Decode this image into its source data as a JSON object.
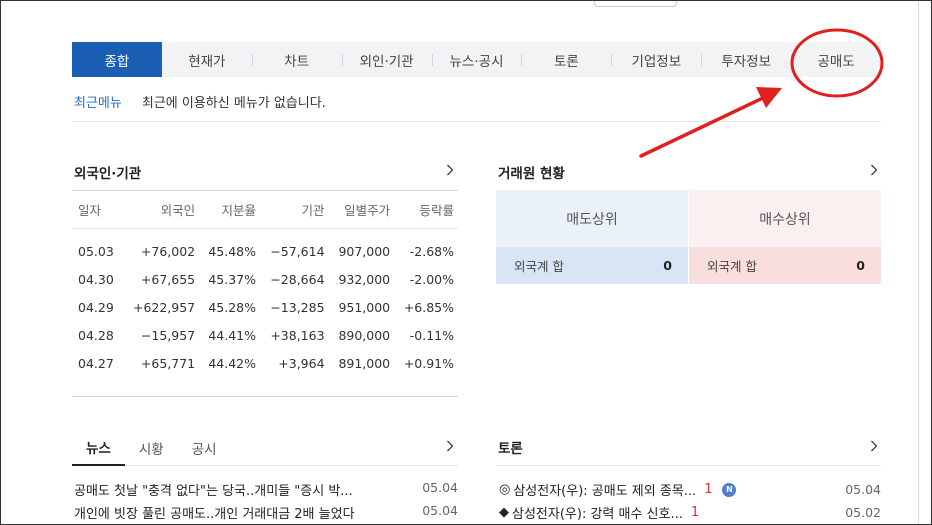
{
  "tabs": [
    "종합",
    "현재가",
    "차트",
    "외인·기관",
    "뉴스·공시",
    "토론",
    "기업정보",
    "투자정보",
    "공매도"
  ],
  "recent": {
    "label": "최근메뉴",
    "message": "최근에 이용하신 메뉴가 없습니다."
  },
  "foreign": {
    "title": "외국인·기관",
    "headers": [
      "일자",
      "외국인",
      "지분율",
      "기관",
      "일별주가",
      "등락률"
    ],
    "rows": [
      [
        "05.03",
        "+76,002",
        "45.48%",
        "−57,614",
        "907,000",
        "-2.68%"
      ],
      [
        "04.30",
        "+67,655",
        "45.37%",
        "−28,664",
        "932,000",
        "-2.00%"
      ],
      [
        "04.29",
        "+622,957",
        "45.28%",
        "−13,285",
        "951,000",
        "+6.85%"
      ],
      [
        "04.28",
        "−15,957",
        "44.41%",
        "+38,163",
        "890,000",
        "-0.11%"
      ],
      [
        "04.27",
        "+65,771",
        "44.42%",
        "+3,964",
        "891,000",
        "+0.91%"
      ]
    ]
  },
  "broker": {
    "title": "거래원 현황",
    "sell_label": "매도상위",
    "buy_label": "매수상위",
    "sell_row": {
      "label": "외국계 합",
      "value": "0"
    },
    "buy_row": {
      "label": "외국계 합",
      "value": "0"
    }
  },
  "news": {
    "tabs": [
      "뉴스",
      "시황",
      "공시"
    ],
    "items": [
      {
        "title": "공매도 첫날 \"충격 없다\"는 당국..개미들 \"증시 박...",
        "date": "05.04"
      },
      {
        "title": "개인에 빗장 풀린 공매도..개인 거래대금 2배 늘었다",
        "date": "05.04"
      }
    ]
  },
  "talk": {
    "title": "토론",
    "items": [
      {
        "bullet": "◎",
        "title": "삼성전자(우): 공매도 제외 종목...",
        "count": "1",
        "badge": "N",
        "date": "05.04"
      },
      {
        "bullet": "◆",
        "title": "삼성전자(우): 강력 매수 신호...",
        "count": "1",
        "date": "05.02"
      }
    ]
  },
  "colors": {
    "active_tab": "#1b5fb4",
    "up": "#d9322f",
    "down": "#2a58a5",
    "annotation": "#e0201e"
  },
  "icons": [
    "chevron-right-icon",
    "new-badge-icon"
  ]
}
